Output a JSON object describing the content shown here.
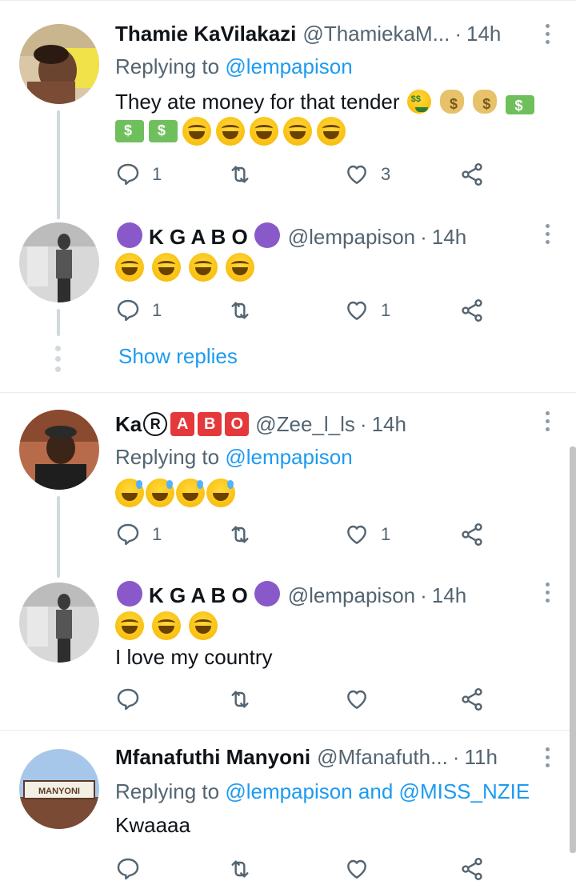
{
  "replying_prefix": "Replying to",
  "show_replies_label": "Show replies",
  "tweets": [
    {
      "name": "Thamie KaVilakazi",
      "handle": "@ThamiekaM...",
      "time": "14h",
      "reply_to": "@lempapison",
      "text": "They ate money for that tender",
      "emojis_inline": [
        "money-mouth-face",
        "money-bag",
        "money-bag",
        "dollar-banknote"
      ],
      "emojis_line2": [
        "dollar-banknote",
        "dollar-banknote",
        "face-with-tears-of-joy",
        "face-with-tears-of-joy",
        "face-with-tears-of-joy",
        "face-with-tears-of-joy",
        "face-with-tears-of-joy"
      ],
      "replies": "1",
      "retweets": "",
      "likes": "3"
    },
    {
      "name": "K G A B O",
      "name_emoji": "smiling-face-with-horns",
      "handle": "@lempapison",
      "time": "14h",
      "emojis": [
        "face-with-tears-of-joy",
        "face-with-tears-of-joy",
        "face-with-tears-of-joy",
        "face-with-tears-of-joy"
      ],
      "replies": "1",
      "retweets": "",
      "likes": "1"
    },
    {
      "name_prefix": "Ka",
      "name_letters": [
        "R",
        "A",
        "B",
        "O"
      ],
      "handle": "@Zee_l_ls",
      "time": "14h",
      "reply_to": "@lempapison",
      "emojis": [
        "grinning-face-with-sweat",
        "grinning-face-with-sweat",
        "grinning-face-with-sweat",
        "grinning-face-with-sweat"
      ],
      "replies": "1",
      "retweets": "",
      "likes": "1"
    },
    {
      "name": "K G A B O",
      "name_emoji": "smiling-face-with-horns",
      "handle": "@lempapison",
      "time": "14h",
      "emojis": [
        "face-with-tears-of-joy",
        "face-with-tears-of-joy",
        "face-with-tears-of-joy"
      ],
      "text": "I love my country",
      "replies": "",
      "retweets": "",
      "likes": ""
    },
    {
      "name": "Mfanafuthi Manyoni",
      "handle": "@Mfanafuth...",
      "time": "11h",
      "reply_to": "@lempapison",
      "reply_and": "and",
      "reply_to_2": "@MISS_NZIE",
      "avatar_sign": "MANYONI",
      "text": "Kwaaaa",
      "replies": "",
      "retweets": "",
      "likes": ""
    }
  ],
  "colors": {
    "link": "#1d9bf0",
    "secondary": "#536471",
    "primary_text": "#0f1419",
    "thread_line": "#cfd9de",
    "devil_purple": "#8a59c9",
    "letter_red": "#e5383b"
  },
  "icons": {
    "reply": "reply-icon",
    "retweet": "retweet-icon",
    "like": "heart-icon",
    "share": "share-icon",
    "more": "more-vertical-icon"
  }
}
